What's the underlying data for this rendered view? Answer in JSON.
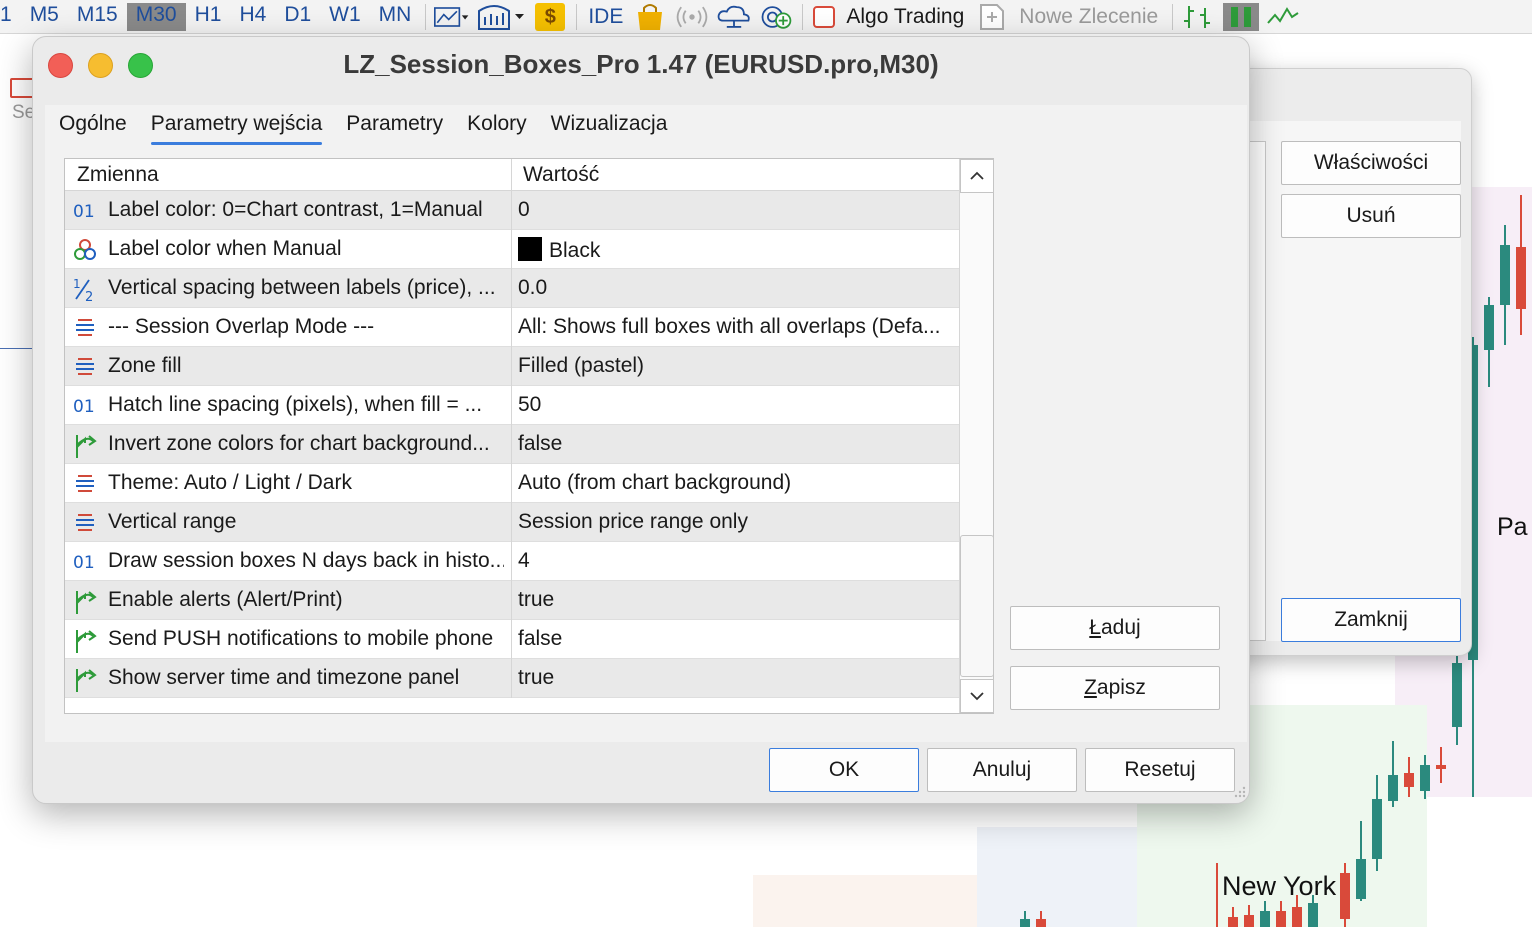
{
  "toolbar": {
    "timeframes": [
      "1",
      "M5",
      "M15",
      "M30",
      "H1",
      "H4",
      "D1",
      "W1",
      "MN"
    ],
    "active_timeframe": "M30",
    "ide_label": "IDE",
    "algo_trading": "Algo Trading",
    "new_order": "Nowe Zlecenie"
  },
  "background": {
    "se_label": "Se",
    "chart_label_pa": "Pa",
    "chart_label_ny": "New York"
  },
  "bg_dialog": {
    "properties_button": "Właściwości",
    "delete_button": "Usuń",
    "close_button": "Zamknij"
  },
  "dialog": {
    "title": "LZ_Session_Boxes_Pro 1.47 (EURUSD.pro,M30)",
    "tabs": [
      "Ogólne",
      "Parametry wejścia",
      "Parametry",
      "Kolory",
      "Wizualizacja"
    ],
    "active_tab": "Parametry wejścia",
    "grid": {
      "col_variable": "Zmienna",
      "col_value": "Wartość",
      "rows": [
        {
          "icon": "int",
          "name": "Label color: 0=Chart contrast, 1=Manual",
          "value": "0"
        },
        {
          "icon": "color",
          "name": "Label color when Manual",
          "value": "Black",
          "swatch": "#000000"
        },
        {
          "icon": "fraction",
          "name": "Vertical spacing between labels (price), ...",
          "value": "0.0"
        },
        {
          "icon": "enum",
          "name": "--- Session Overlap Mode ---",
          "value": "All: Shows full boxes with all overlaps (Defa..."
        },
        {
          "icon": "enum",
          "name": "Zone fill",
          "value": "Filled (pastel)"
        },
        {
          "icon": "int",
          "name": "Hatch line spacing (pixels), when fill = ...",
          "value": "50"
        },
        {
          "icon": "bool",
          "name": "Invert zone colors for chart background...",
          "value": "false"
        },
        {
          "icon": "enum",
          "name": "Theme: Auto / Light / Dark",
          "value": "Auto (from chart background)"
        },
        {
          "icon": "enum",
          "name": "Vertical range",
          "value": "Session price range only"
        },
        {
          "icon": "int",
          "name": "Draw session boxes N days back in histo...",
          "value": "4"
        },
        {
          "icon": "bool",
          "name": "Enable alerts (Alert/Print)",
          "value": "true"
        },
        {
          "icon": "bool",
          "name": "Send PUSH notifications to mobile phone",
          "value": "false"
        },
        {
          "icon": "bool",
          "name": "Show server time and timezone panel",
          "value": "true"
        }
      ]
    },
    "load_button": {
      "underline": "Ł",
      "rest": "aduj"
    },
    "save_button": {
      "underline": "Z",
      "rest": "apisz"
    },
    "ok_button": "OK",
    "cancel_button": "Anuluj",
    "reset_button": "Resetuj"
  },
  "colors": {
    "accent": "#3b7ddd",
    "link_blue": "#1f4e9c",
    "int_icon": "#1f5fbf",
    "bool_icon": "#2e9b3a",
    "enum_icon": "#d04a3a"
  }
}
